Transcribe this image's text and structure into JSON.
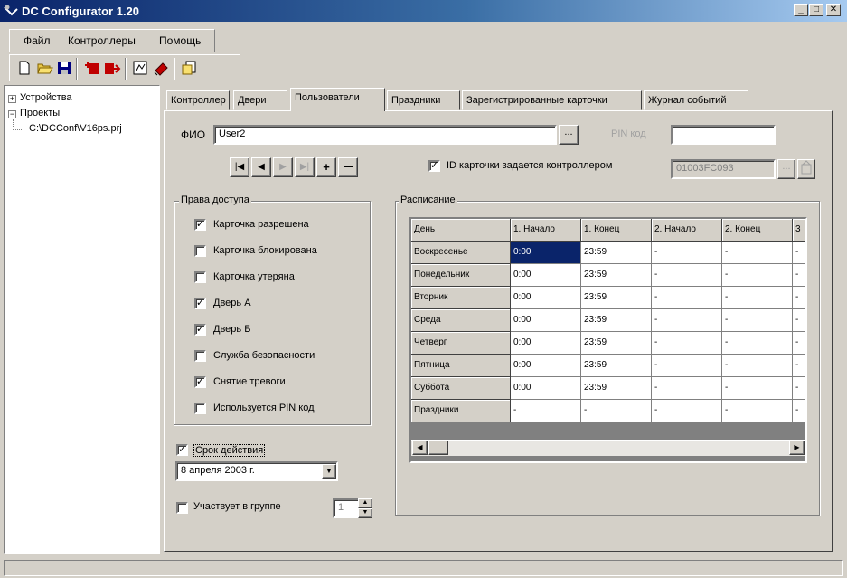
{
  "window": {
    "title": "DC Configurator 1.20"
  },
  "menu": [
    "Файл",
    "Контроллеры",
    "Помощь"
  ],
  "tree": {
    "devices": "Устройства",
    "projects": "Проекты",
    "project_file": "C:\\DCConf\\V16ps.prj"
  },
  "tabs": [
    "Контроллер",
    "Двери",
    "Пользователи",
    "Праздники",
    "Зарегистрированные карточки",
    "Журнал событий"
  ],
  "user": {
    "fio_label": "ФИО",
    "fio_value": "User2",
    "browse_label": "...",
    "pin_label": "PIN код",
    "pin_value": "",
    "id_by_controller_label": "ID карточки задается контроллером",
    "card_id_value": "01003FC093",
    "card_browse_label": "..."
  },
  "nav_buttons": [
    "|◀",
    "◀",
    "▶",
    "▶|",
    "+",
    "—"
  ],
  "access": {
    "title": "Права доступа",
    "items": [
      {
        "label": "Карточка разрешена",
        "checked": true
      },
      {
        "label": "Карточка блокирована",
        "checked": false
      },
      {
        "label": "Карточка утеряна",
        "checked": false
      },
      {
        "label": "Дверь A",
        "checked": true
      },
      {
        "label": "Дверь Б",
        "checked": true
      },
      {
        "label": "Служба безопасности",
        "checked": false
      },
      {
        "label": "Снятие тревоги",
        "checked": true
      },
      {
        "label": "Используется PIN код",
        "checked": false
      }
    ]
  },
  "validity": {
    "label": "Срок действия",
    "checked": true,
    "date": "8  апреля  2003 г."
  },
  "group": {
    "label": "Участвует в группе",
    "checked": false,
    "value": "1"
  },
  "schedule": {
    "title": "Расписание",
    "headers": [
      "День",
      "1. Начало",
      "1. Конец",
      "2. Начало",
      "2. Конец",
      "3"
    ],
    "rows": [
      [
        "Воскресенье",
        "0:00",
        "23:59",
        "-",
        "-",
        "-"
      ],
      [
        "Понедельник",
        "0:00",
        "23:59",
        "-",
        "-",
        "-"
      ],
      [
        "Вторник",
        "0:00",
        "23:59",
        "-",
        "-",
        "-"
      ],
      [
        "Среда",
        "0:00",
        "23:59",
        "-",
        "-",
        "-"
      ],
      [
        "Четверг",
        "0:00",
        "23:59",
        "-",
        "-",
        "-"
      ],
      [
        "Пятница",
        "0:00",
        "23:59",
        "-",
        "-",
        "-"
      ],
      [
        "Суббота",
        "0:00",
        "23:59",
        "-",
        "-",
        "-"
      ],
      [
        "Праздники",
        "-",
        "-",
        "-",
        "-",
        "-"
      ]
    ]
  },
  "colors": {
    "title_start": "#0a246a",
    "title_end": "#a6caf0",
    "selection": "#0a246a",
    "face": "#d4d0c8"
  }
}
